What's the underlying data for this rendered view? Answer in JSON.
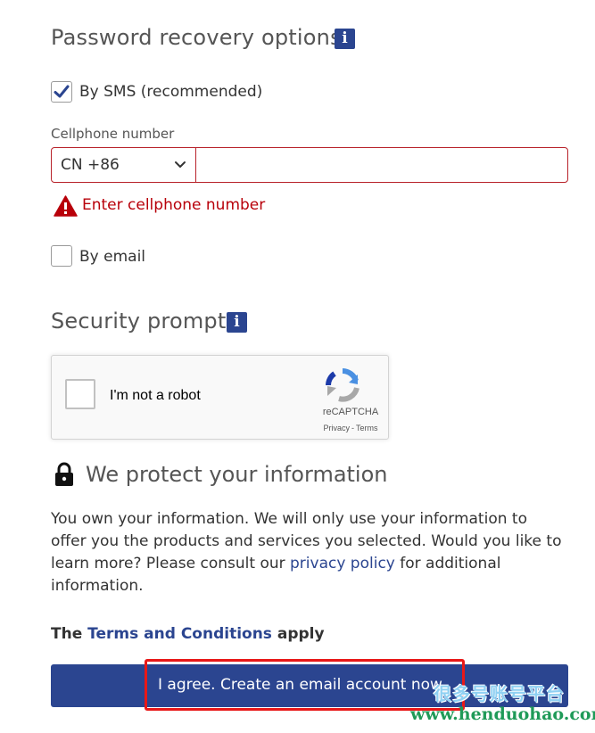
{
  "password_recovery": {
    "title": "Password recovery options",
    "info_icon": "i",
    "sms_option": {
      "label": "By SMS (recommended)",
      "checked": true
    },
    "cellphone_label": "Cellphone number",
    "country_code": "CN +86",
    "phone_value": "",
    "error_message": "Enter cellphone number",
    "email_option": {
      "label": "By email",
      "checked": false
    }
  },
  "security_prompt": {
    "title": "Security prompt",
    "info_icon": "i",
    "recaptcha": {
      "label": "I'm not a robot",
      "brand": "reCAPTCHA",
      "privacy_link": "Privacy",
      "separator": "-",
      "terms_link": "Terms"
    }
  },
  "protect": {
    "title": "We protect your information",
    "paragraph_before_link": "You own your information. We will only use your information to offer you the products and services you selected. Would you like to learn more? Please consult our ",
    "privacy_link": "privacy policy",
    "paragraph_after_link": " for additional information."
  },
  "terms": {
    "prefix": "The ",
    "link": "Terms and Conditions",
    "suffix": " apply"
  },
  "submit_button": {
    "label": "I agree. Create an email account now"
  },
  "watermark": {
    "cn": "很多号账号平台",
    "url": "www.henduohao.com"
  },
  "colors": {
    "accent": "#2b4590",
    "error": "#b8000a",
    "highlight": "#e81818"
  }
}
